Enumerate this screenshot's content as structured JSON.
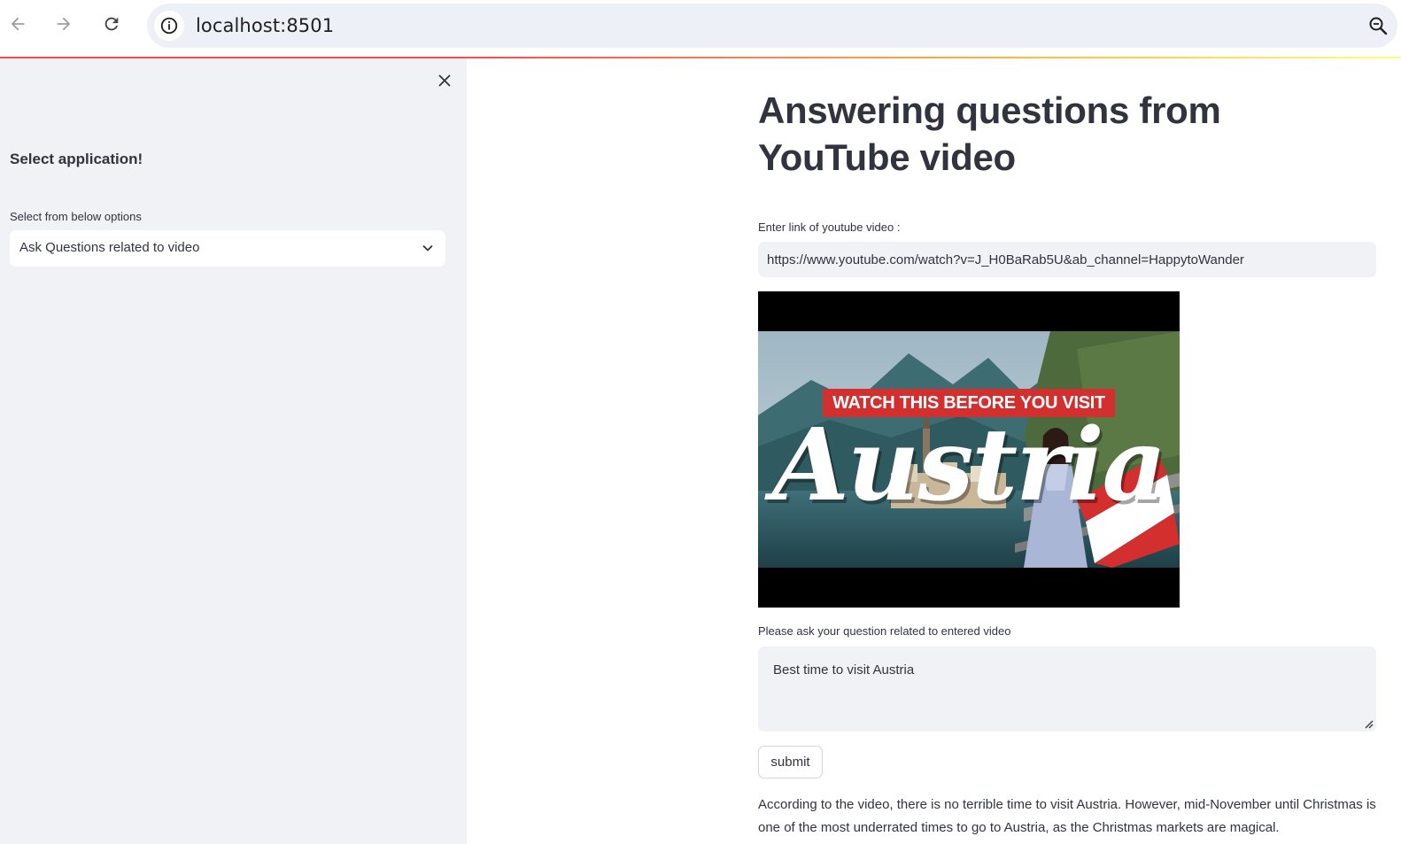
{
  "browser": {
    "url": "localhost:8501",
    "icons": {
      "back": "arrow-left-icon",
      "forward": "arrow-right-icon",
      "reload": "reload-icon",
      "info": "info-icon",
      "zoom": "zoom-icon"
    }
  },
  "sidebar": {
    "heading": "Select application!",
    "select_label": "Select from below options",
    "select_value": "Ask Questions related to video",
    "close_icon": "close-icon"
  },
  "main": {
    "title": "Answering questions from YouTube video",
    "url_label": "Enter link of youtube video :",
    "url_value": "https://www.youtube.com/watch?v=J_H0BaRab5U&ab_channel=HappytoWander",
    "video": {
      "banner_text": "WATCH THIS BEFORE YOU VISIT",
      "script_text": "Austria"
    },
    "question_label": "Please ask your question related to entered video",
    "question_value": "Best time to visit Austria",
    "submit_label": "submit",
    "answer": "According to the video, there is no terrible time to visit Austria. However, mid-November until Christmas is one of the most underrated times to go to Austria, as the Christmas markets are magical."
  },
  "colors": {
    "sidebar_bg": "#f0f2f6",
    "input_bg": "#f0f2f6",
    "text": "#31333f",
    "accent_red": "#ff4b4b",
    "banner_red": "#d32f2f"
  }
}
